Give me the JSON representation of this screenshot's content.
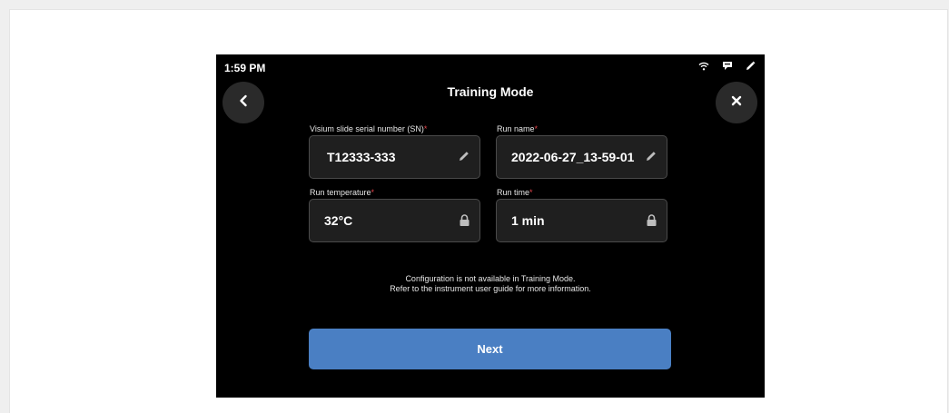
{
  "status_bar": {
    "time": "1:59 PM",
    "icons": [
      "wifi-icon",
      "chat-icon",
      "pencil-icon"
    ]
  },
  "header": {
    "title": "Training Mode",
    "back_icon": "chevron-left-icon",
    "close_icon": "close-icon"
  },
  "fields": {
    "serial": {
      "label": "Visium slide serial number (SN)",
      "required": "*",
      "value": "T12333-333",
      "icon": "pencil-icon"
    },
    "run_name": {
      "label": "Run name",
      "required": "*",
      "value": "2022-06-27_13-59-01",
      "icon": "pencil-icon"
    },
    "temperature": {
      "label": "Run temperature",
      "required": "*",
      "value": "32°C",
      "icon": "lock-icon"
    },
    "run_time": {
      "label": "Run time",
      "required": "*",
      "value": "1 min",
      "icon": "lock-icon"
    }
  },
  "info": {
    "line1": "Configuration is not available in Training Mode.",
    "line2": "Refer to the instrument user guide for more information."
  },
  "next_button": {
    "label": "Next"
  },
  "colors": {
    "screen_bg": "#000000",
    "field_bg": "#1f1f1f",
    "accent": "#4a7fc3",
    "required": "#e2444a"
  }
}
